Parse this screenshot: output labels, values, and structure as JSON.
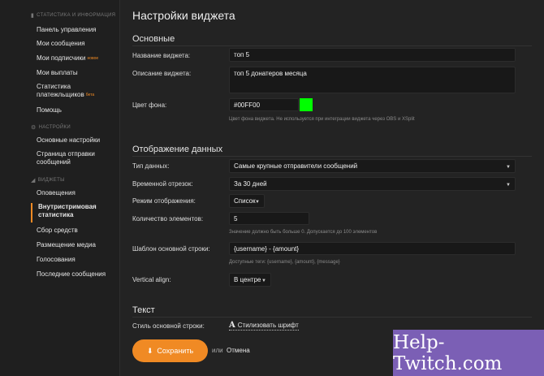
{
  "sidebar": {
    "sections": [
      {
        "title": "СТАТИСТИКА И ИНФОРМАЦИЯ",
        "icon": "chart-icon"
      },
      {
        "title": "НАСТРОЙКИ",
        "icon": "gear-icon"
      },
      {
        "title": "ВИДЖЕТЫ",
        "icon": "widget-icon"
      }
    ],
    "items": [
      {
        "label": "Панель управления"
      },
      {
        "label": "Мои сообщения"
      },
      {
        "label": "Мои подписчики",
        "badge": "новое"
      },
      {
        "label": "Мои выплаты"
      },
      {
        "label": "Статистика платежльщиков",
        "badge": "бета"
      },
      {
        "label": "Помощь"
      },
      {
        "label": "Основные настройки"
      },
      {
        "label": "Страница отправки сообщений"
      },
      {
        "label": "Оповещения"
      },
      {
        "label": "Внутристримовая статистика"
      },
      {
        "label": "Сбор средств"
      },
      {
        "label": "Размещение медиа"
      },
      {
        "label": "Голосования"
      },
      {
        "label": "Последние сообщения"
      }
    ]
  },
  "main": {
    "title": "Настройки виджета",
    "basic": {
      "heading": "Основные",
      "name_label": "Название виджета:",
      "name_value": "топ 5",
      "desc_label": "Описание виджета:",
      "desc_value": "топ 5 донатеров месяца",
      "bg_label": "Цвет фона:",
      "bg_value": "#00FF00",
      "bg_color": "#00ff00",
      "bg_hint": "Цвет фона виджета. Не используется при интеграции виджета через OBS и XSplit"
    },
    "display": {
      "heading": "Отображение данных",
      "type_label": "Тип данных:",
      "type_value": "Самые крупные отправители сообщений",
      "period_label": "Временной отрезок:",
      "period_value": "За 30 дней",
      "mode_label": "Режим отображения:",
      "mode_value": "Список",
      "count_label": "Количество элементов:",
      "count_value": "5",
      "count_hint": "Значение должно быть больше 0. Допускается до 100 элементов",
      "template_label": "Шаблон основной строки:",
      "template_value": "{username} - {amount}",
      "template_hint": "Доступные теги: {username}, {amount}, {message}",
      "valign_label": "Vertical align:",
      "valign_value": "В центре"
    },
    "text": {
      "heading": "Текст",
      "style_label": "Стиль основной строки:",
      "style_button": "Стилизовать шрифт"
    },
    "actions": {
      "save": "Сохранить",
      "or": "или",
      "cancel": "Отмена"
    }
  },
  "watermark": "Help-Twitch.com",
  "colors": {
    "accent": "#f08a24",
    "background": "#232323",
    "swatch": "#00ff00",
    "watermark_bg": "#7b5fb5"
  }
}
